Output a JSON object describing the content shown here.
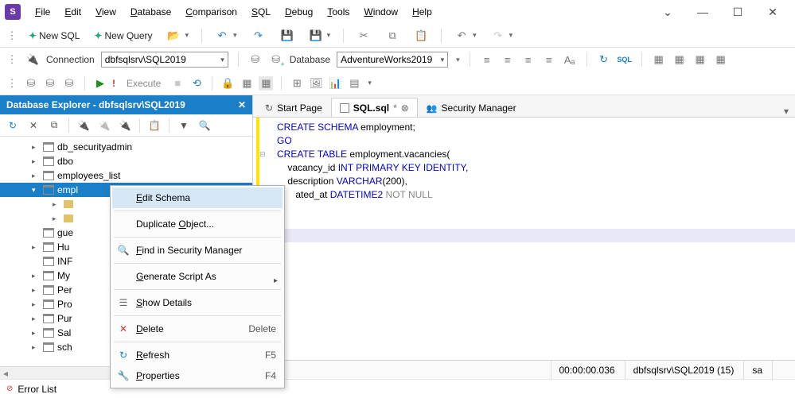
{
  "app": {
    "icon_letter": "S"
  },
  "menus": [
    "File",
    "Edit",
    "View",
    "Database",
    "Comparison",
    "SQL",
    "Debug",
    "Tools",
    "Window",
    "Help"
  ],
  "toolbar1": {
    "new_sql": "New SQL",
    "new_query": "New Query"
  },
  "connection": {
    "label": "Connection",
    "value": "dbfsqlsrv\\SQL2019",
    "db_label": "Database",
    "db_value": "AdventureWorks2019"
  },
  "toolbar3": {
    "execute": "Execute"
  },
  "explorer": {
    "title": "Database Explorer - dbfsqlsrv\\SQL2019",
    "items": [
      {
        "label": "db_securityadmin",
        "type": "schema",
        "exp": "▸"
      },
      {
        "label": "dbo",
        "type": "schema",
        "exp": "▸"
      },
      {
        "label": "employees_list",
        "type": "schema",
        "exp": "▸"
      },
      {
        "label": "empl",
        "type": "schema",
        "exp": "▾",
        "selected": true
      },
      {
        "label": "",
        "type": "folder",
        "exp": "▸",
        "child": true
      },
      {
        "label": "",
        "type": "folder",
        "exp": "▸",
        "child": true
      },
      {
        "label": "gue",
        "type": "schema",
        "exp": ""
      },
      {
        "label": "Hu",
        "type": "schema",
        "exp": "▸"
      },
      {
        "label": "INF",
        "type": "schema",
        "exp": ""
      },
      {
        "label": "My",
        "type": "schema",
        "exp": "▸"
      },
      {
        "label": "Per",
        "type": "schema",
        "exp": "▸"
      },
      {
        "label": "Pro",
        "type": "schema",
        "exp": "▸"
      },
      {
        "label": "Pur",
        "type": "schema",
        "exp": "▸"
      },
      {
        "label": "Sal",
        "type": "schema",
        "exp": "▸"
      },
      {
        "label": "sch",
        "type": "schema",
        "exp": "▸"
      }
    ]
  },
  "context_menu": {
    "items": [
      {
        "label": "Edit Schema",
        "hover": true,
        "u": "E"
      },
      {
        "sep": true
      },
      {
        "label": "Duplicate Object...",
        "u": "O"
      },
      {
        "sep": true
      },
      {
        "label": "Find in Security Manager",
        "icon": "🔍",
        "u": "F"
      },
      {
        "sep": true
      },
      {
        "label": "Generate Script As",
        "sub": true,
        "u": "G"
      },
      {
        "sep": true
      },
      {
        "label": "Show Details",
        "icon": "☰",
        "u": "S"
      },
      {
        "sep": true
      },
      {
        "label": "Delete",
        "icon": "✕",
        "shortcut": "Delete",
        "u": "D",
        "iconcolor": "red"
      },
      {
        "sep": true
      },
      {
        "label": "Refresh",
        "icon": "↻",
        "shortcut": "F5",
        "u": "R",
        "iconcolor": "blue"
      },
      {
        "label": "Properties",
        "icon": "🔧",
        "shortcut": "F4",
        "u": "P"
      }
    ]
  },
  "tabs": [
    {
      "label": "Start Page",
      "icon": "starpg"
    },
    {
      "label": "SQL.sql*",
      "icon": "sqlfile",
      "active": true,
      "dirty": true
    },
    {
      "label": "Security Manager",
      "icon": "secmgr"
    }
  ],
  "editor": {
    "lines": [
      {
        "tokens": [
          {
            "t": "CREATE SCHEMA",
            "c": "kw"
          },
          {
            "t": " employment;",
            "c": "ident"
          }
        ]
      },
      {
        "tokens": [
          {
            "t": "GO",
            "c": "kw"
          }
        ]
      },
      {
        "tokens": []
      },
      {
        "tokens": [
          {
            "t": "CREATE TABLE",
            "c": "kw"
          },
          {
            "t": " employment.vacancies(",
            "c": "ident"
          }
        ],
        "fold": "⊟"
      },
      {
        "tokens": [
          {
            "t": "    vacancy_id ",
            "c": "ident"
          },
          {
            "t": "INT PRIMARY KEY IDENTITY",
            "c": "type"
          },
          {
            "t": ",",
            "c": "ident"
          }
        ]
      },
      {
        "tokens": [
          {
            "t": "    description ",
            "c": "ident"
          },
          {
            "t": "VARCHAR",
            "c": "type"
          },
          {
            "t": "(",
            "c": "ident"
          },
          {
            "t": "200",
            "c": "num"
          },
          {
            "t": "),",
            "c": "ident"
          }
        ]
      },
      {
        "tokens": [
          {
            "t": "       ated_at ",
            "c": "ident"
          },
          {
            "t": "DATETIME2",
            "c": "type"
          },
          {
            "t": " NOT NULL",
            "c": "gray"
          }
        ]
      }
    ],
    "highlight_line": 8
  },
  "statusbar": {
    "time": "00:00:00.036",
    "conn": "dbfsqlsrv\\SQL2019 (15)",
    "user": "sa"
  },
  "bottom": {
    "error_list": "Error List"
  }
}
